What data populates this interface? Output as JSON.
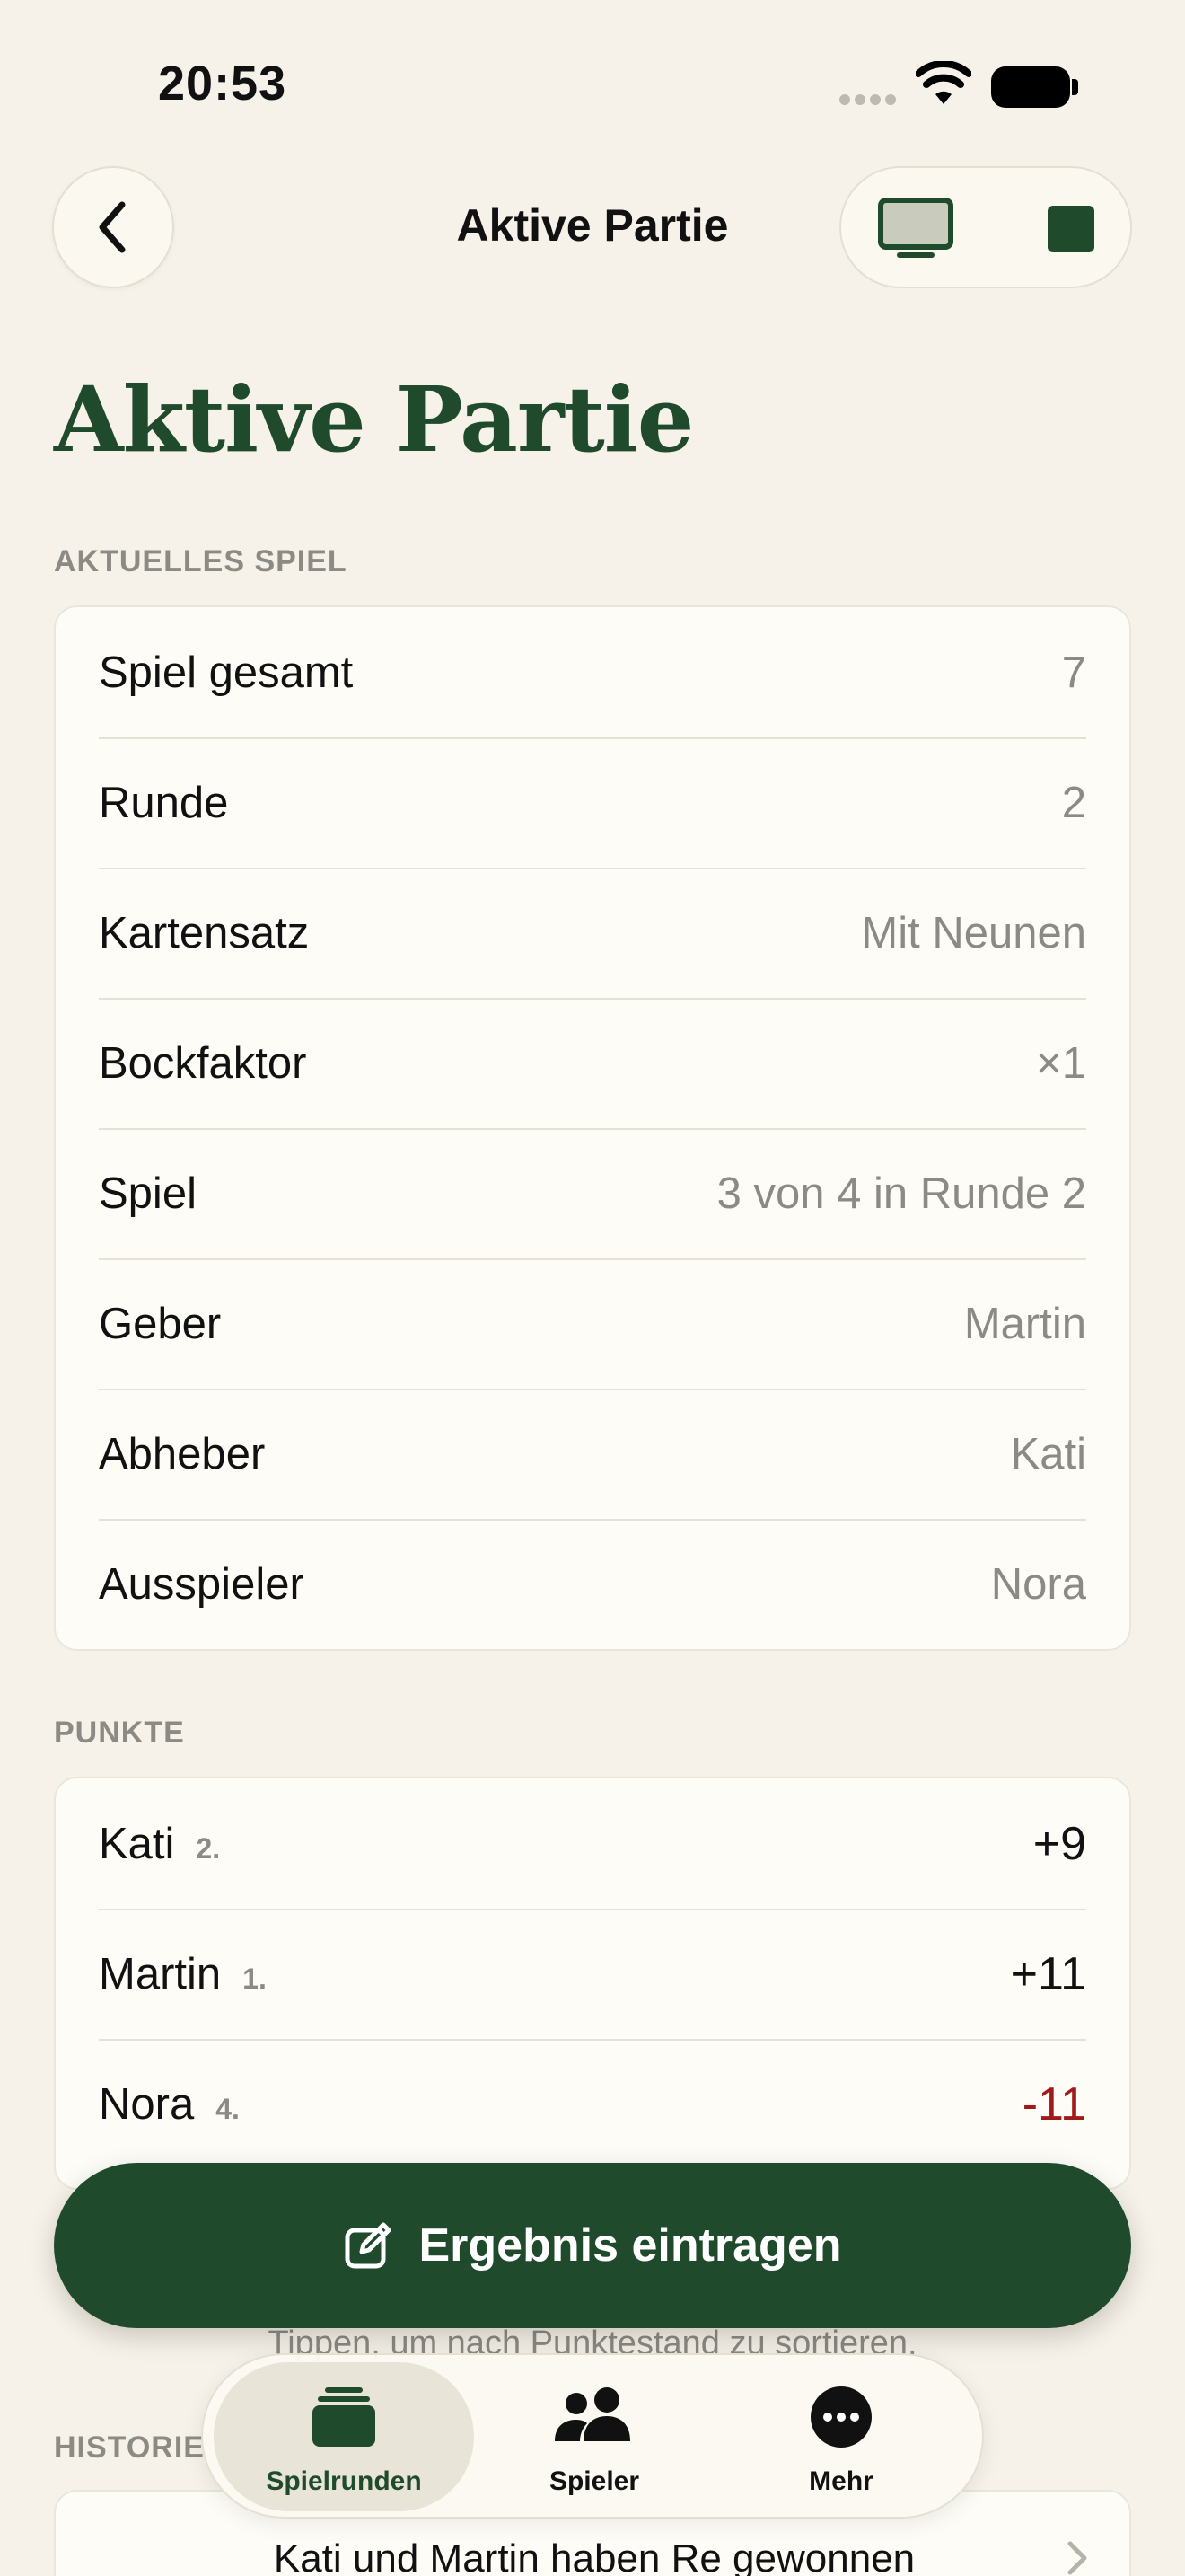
{
  "status": {
    "time": "20:53"
  },
  "nav": {
    "title": "Aktive Partie"
  },
  "large_title": "Aktive Partie",
  "sections": {
    "current_game_header": "AKTUELLES SPIEL",
    "points_header": "PUNKTE",
    "history_header": "HISTORIE"
  },
  "current_game": [
    {
      "label": "Spiel gesamt",
      "value": "7"
    },
    {
      "label": "Runde",
      "value": "2"
    },
    {
      "label": "Kartensatz",
      "value": "Mit Neunen"
    },
    {
      "label": "Bockfaktor",
      "value": "×1"
    },
    {
      "label": "Spiel",
      "value": "3 von 4 in Runde 2"
    },
    {
      "label": "Geber",
      "value": "Martin"
    },
    {
      "label": "Abheber",
      "value": "Kati"
    },
    {
      "label": "Ausspieler",
      "value": "Nora"
    }
  ],
  "points": [
    {
      "name": "Kati",
      "rank": "2.",
      "score": "+9"
    },
    {
      "name": "Martin",
      "rank": "1.",
      "score": "+11"
    },
    {
      "name": "Nora",
      "rank": "4.",
      "score": "-11"
    }
  ],
  "primary_button": {
    "label": "Ergebnis eintragen"
  },
  "hint": "Tippen, um nach Punktestand zu sortieren.",
  "history": [
    {
      "text": "Kati und Martin haben Re gewonnen"
    }
  ],
  "tabs": [
    {
      "label": "Spielrunden",
      "icon": "cards-stack-icon",
      "active": true
    },
    {
      "label": "Spieler",
      "icon": "people-icon",
      "active": false
    },
    {
      "label": "Mehr",
      "icon": "ellipsis-circle-icon",
      "active": false
    }
  ],
  "colors": {
    "accent": "#1f4a2c",
    "negative": "#a11a1a",
    "background": "#f6f2e9",
    "card": "#fefcf7"
  }
}
